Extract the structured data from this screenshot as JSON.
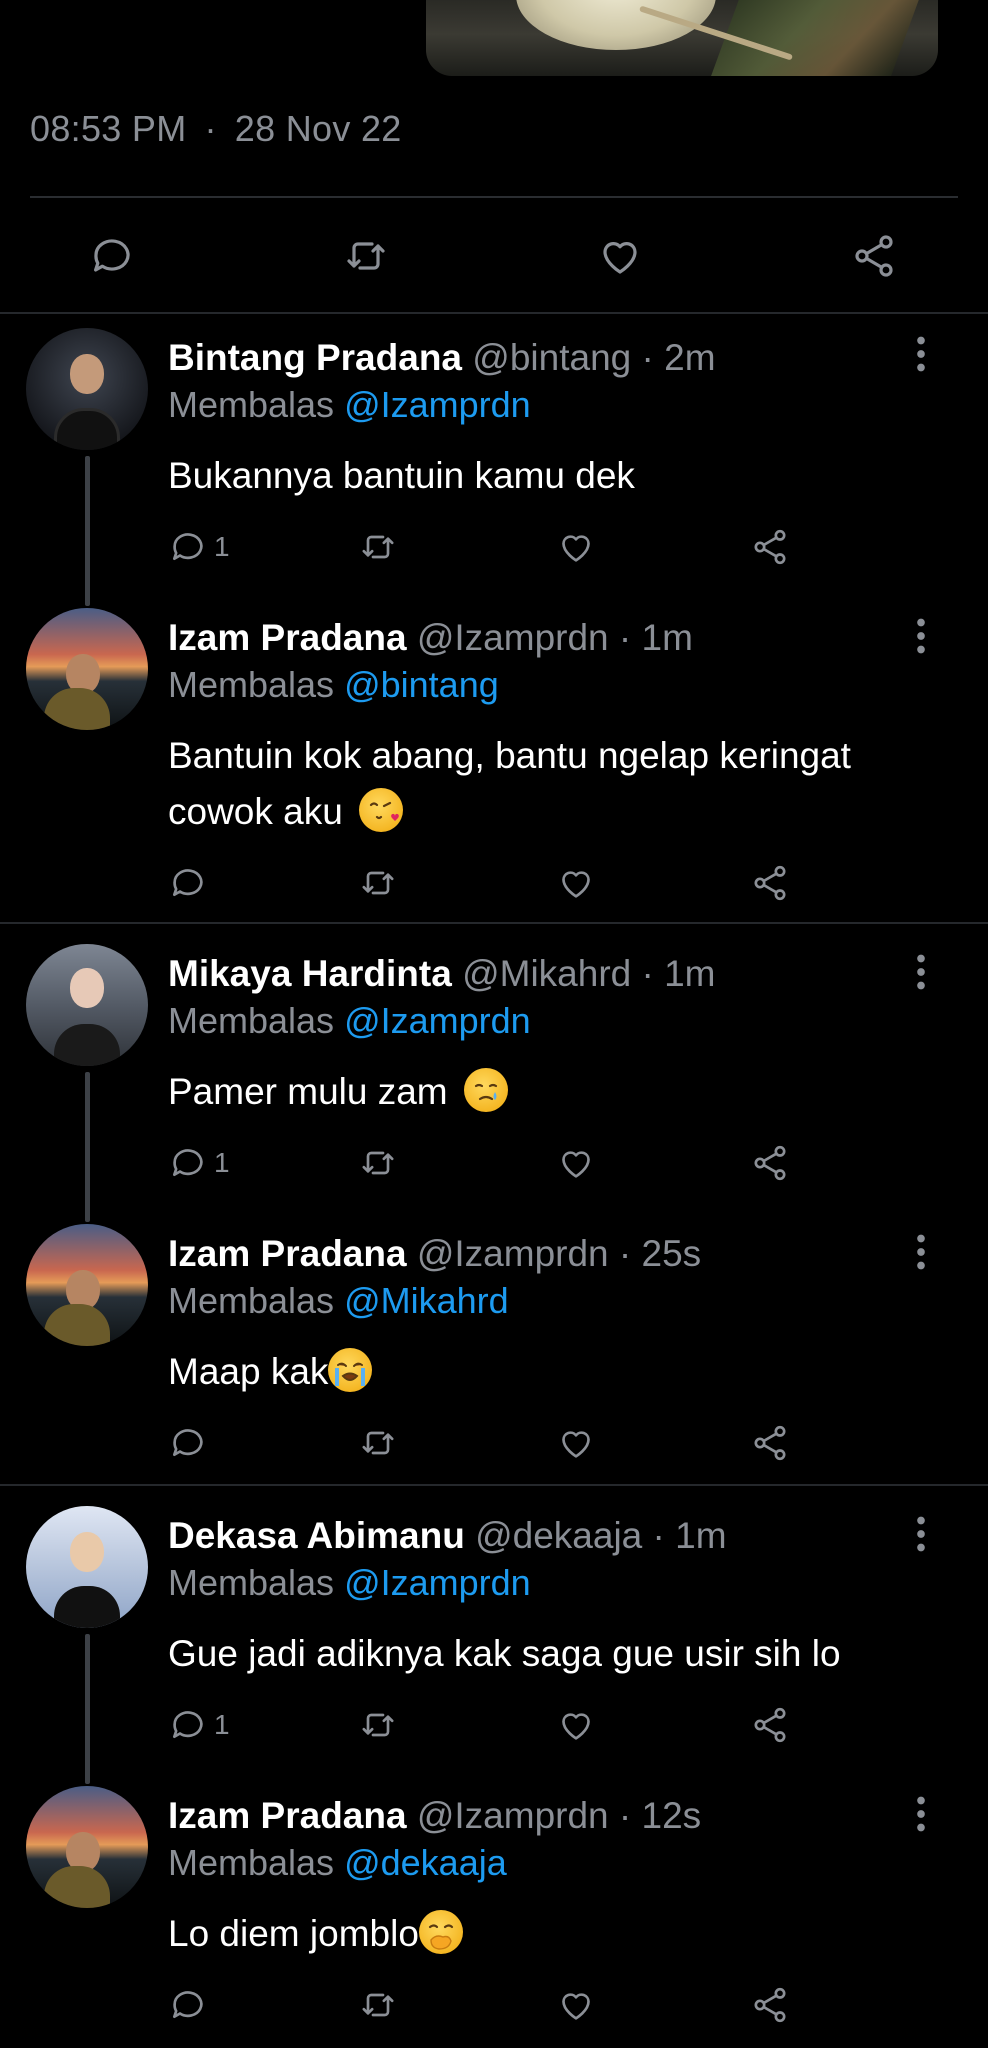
{
  "tweet": {
    "time": "08:53 PM",
    "separator": "·",
    "date": "28 Nov 22"
  },
  "icons": {
    "reply": "reply-icon",
    "retweet": "retweet-icon",
    "like": "heart-icon",
    "share": "share-icon",
    "more": "more-vertical-icon"
  },
  "colors": {
    "background": "#000000",
    "text": "#ffffff",
    "muted": "#8b8f96",
    "link": "#1d9bf0",
    "divider": "#25282c"
  },
  "replies": [
    {
      "name": "Bintang Pradana",
      "handle": "@bintang",
      "time": "· 2m",
      "replying_label": "Membalas",
      "replying_to": "@Izamprdn",
      "text": "Bukannya bantuin kamu dek",
      "emoji": "",
      "reply_count": "1"
    },
    {
      "name": "Izam Pradana",
      "handle": "@Izamprdn",
      "time": "· 1m",
      "replying_label": "Membalas",
      "replying_to": "@bintang",
      "text": "Bantuin kok abang, bantu ngelap keringat cowok aku",
      "emoji": "face-blowing-kiss",
      "reply_count": ""
    },
    {
      "name": "Mikaya Hardinta",
      "handle": "@Mikahrd",
      "time": "· 1m",
      "replying_label": "Membalas",
      "replying_to": "@Izamprdn",
      "text": "Pamer mulu zam",
      "emoji": "crying-face",
      "reply_count": "1"
    },
    {
      "name": "Izam Pradana",
      "handle": "@Izamprdn",
      "time": "· 25s",
      "replying_label": "Membalas",
      "replying_to": "@Mikahrd",
      "text": "Maap kak",
      "emoji": "loudly-crying-face",
      "reply_count": ""
    },
    {
      "name": "Dekasa Abimanu",
      "handle": "@dekaaja",
      "time": "· 1m",
      "replying_label": "Membalas",
      "replying_to": "@Izamprdn",
      "text": "Gue jadi adiknya kak saga gue usir sih lo",
      "emoji": "",
      "reply_count": "1"
    },
    {
      "name": "Izam Pradana",
      "handle": "@Izamprdn",
      "time": "· 12s",
      "replying_label": "Membalas",
      "replying_to": "@dekaaja",
      "text": "Lo diem jomblo",
      "emoji": "face-with-hand-over-mouth",
      "reply_count": ""
    }
  ]
}
